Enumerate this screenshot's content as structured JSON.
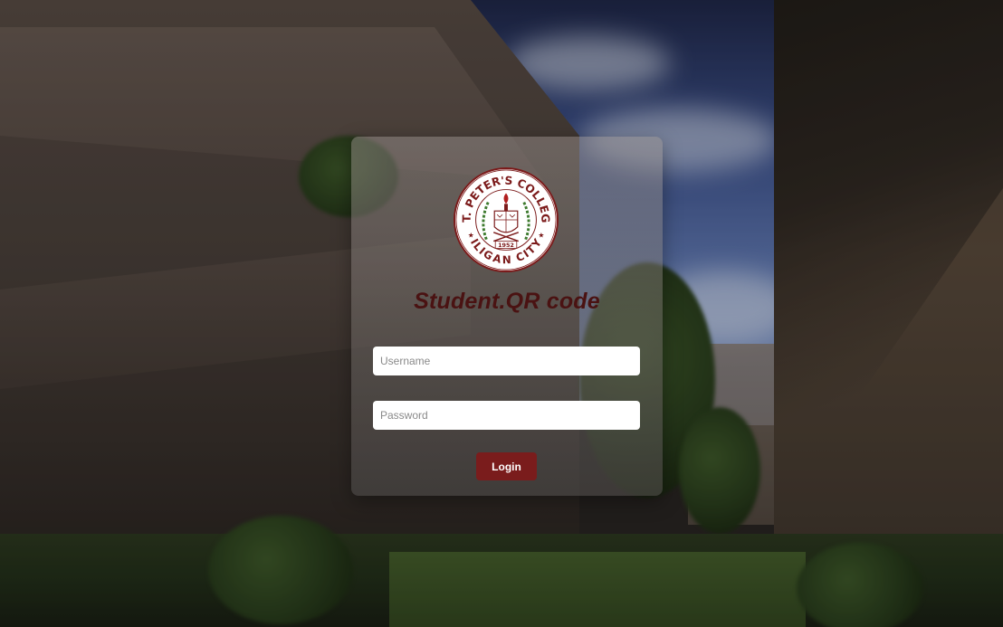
{
  "app": {
    "title": "Student.QR code"
  },
  "logo": {
    "name": "st-peters-college-seal",
    "arc_top": "ST. PETER'S COLLEGE",
    "arc_bottom": "ILIGAN CITY",
    "year": "1952"
  },
  "form": {
    "username_placeholder": "Username",
    "password_placeholder": "Password",
    "login_label": "Login"
  },
  "colors": {
    "brand_maroon": "#7a1c1c",
    "title_color": "#4a1212",
    "seal_maroon": "#7b1a1a",
    "seal_green": "#3d7a2e"
  },
  "icons": {
    "logo": "college-seal-icon"
  }
}
